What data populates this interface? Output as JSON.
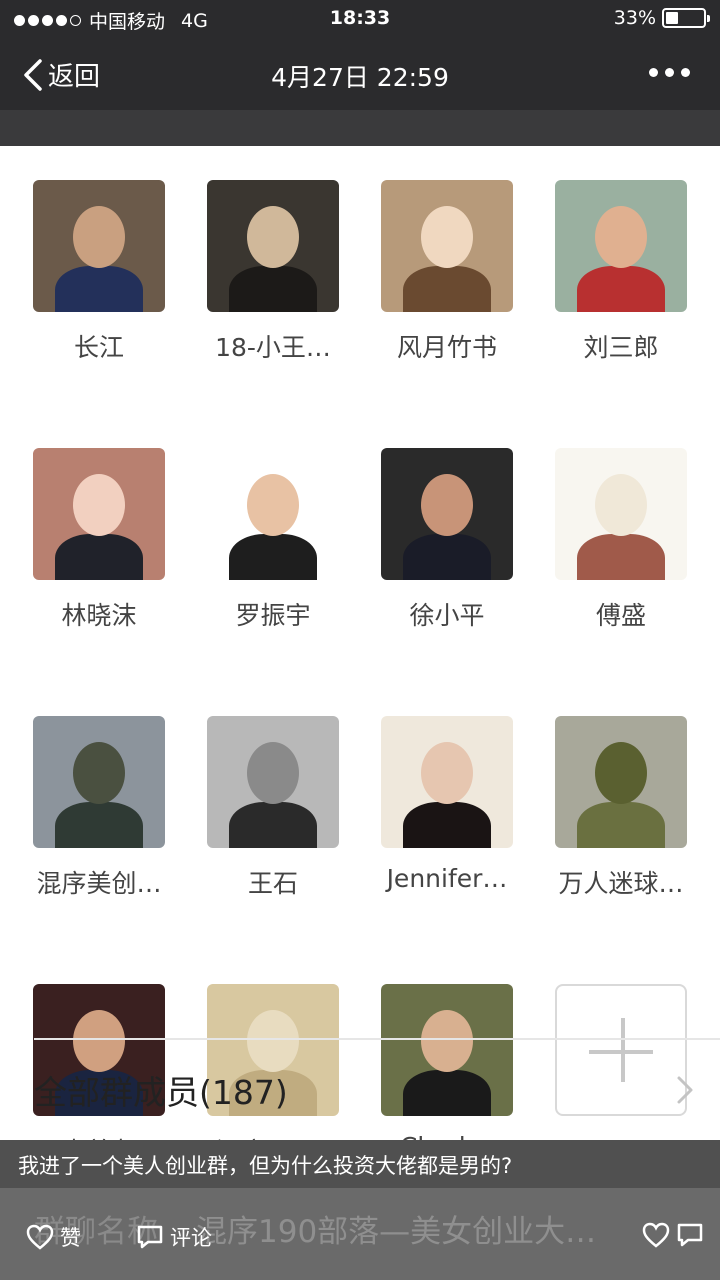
{
  "status_bar": {
    "carrier": "中国移动",
    "network": "4G",
    "time": "18:33",
    "battery_percent": "33%",
    "battery_level": 0.33
  },
  "nav": {
    "back_label": "返回",
    "title": "4月27日 22:59"
  },
  "members": [
    {
      "name": "长江",
      "bg": "#6b5a4a",
      "head": "#c9a080",
      "body": "#23305a"
    },
    {
      "name": "18-小王…",
      "bg": "#3a3630",
      "head": "#d0b89a",
      "body": "#1c1a18"
    },
    {
      "name": "风月竹书",
      "bg": "#b79a7a",
      "head": "#f0d8c0",
      "body": "#6a4a30"
    },
    {
      "name": "刘三郎",
      "bg": "#9ab0a0",
      "head": "#e0b090",
      "body": "#b83030"
    },
    {
      "name": "林晓沫",
      "bg": "#b88070",
      "head": "#f2d0c0",
      "body": "#20222a"
    },
    {
      "name": "罗振宇",
      "bg": "#ffffff",
      "head": "#e8c2a4",
      "body": "#1e1e1e"
    },
    {
      "name": "徐小平",
      "bg": "#2a2a2a",
      "head": "#c89478",
      "body": "#1a1c28"
    },
    {
      "name": "傅盛",
      "bg": "#f8f6f0",
      "head": "#f0e8d8",
      "body": "#a05a4a"
    },
    {
      "name": "混序美创…",
      "bg": "#8c949c",
      "head": "#4a5040",
      "body": "#2f3a34"
    },
    {
      "name": "王石",
      "bg": "#b8b8b8",
      "head": "#8a8a8a",
      "body": "#2a2a2a"
    },
    {
      "name": "Jennifer…",
      "bg": "#efe8dc",
      "head": "#e6c6b0",
      "body": "#1a1414"
    },
    {
      "name": "万人迷球…",
      "bg": "#a8a89a",
      "head": "#5a6030",
      "body": "#6a7040"
    },
    {
      "name": "李善友",
      "bg": "#3a2020",
      "head": "#d0a080",
      "body": "#1a2440"
    },
    {
      "name": "混序Anne",
      "bg": "#d8c8a0",
      "head": "#e8dcc0",
      "body": "#c0ac80"
    },
    {
      "name": "Charles",
      "bg": "#6a7048",
      "head": "#d8b090",
      "body": "#1a1a1a"
    }
  ],
  "all_members_label": "全部群成员(187)",
  "caption": "我进了一个美人创业群，但为什么投资大佬都是男的?",
  "group_name": {
    "label": "群聊名称",
    "value": "混序190部落—美女创业大…"
  },
  "actions": {
    "like_label": "赞",
    "comment_label": "评论"
  }
}
